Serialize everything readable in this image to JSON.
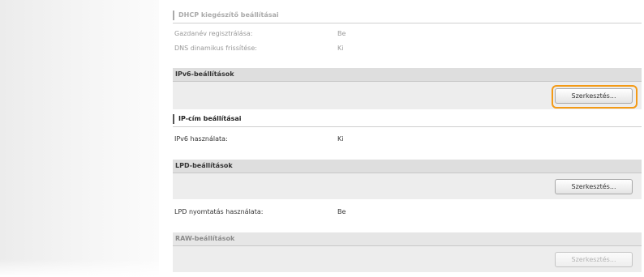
{
  "dhcp": {
    "title": "DHCP kiegészítő beállításai",
    "rows": [
      {
        "label": "Gazdanév regisztrálása:",
        "value": "Be"
      },
      {
        "label": "DNS dinamikus frissítése:",
        "value": "Ki"
      }
    ]
  },
  "ipv6": {
    "header": "IPv6-beállítások",
    "edit_button": "Szerkesztés...",
    "subheading": "IP-cím beállításai",
    "rows": [
      {
        "label": "IPv6 használata:",
        "value": "Ki"
      }
    ]
  },
  "lpd": {
    "header": "LPD-beállítások",
    "edit_button": "Szerkesztés...",
    "rows": [
      {
        "label": "LPD nyomtatás használata:",
        "value": "Be"
      }
    ]
  },
  "raw": {
    "header": "RAW-beállítások",
    "edit_button": "Szerkesztés..."
  },
  "colors": {
    "highlight": "#f39a16",
    "section_header": "#dedede"
  }
}
